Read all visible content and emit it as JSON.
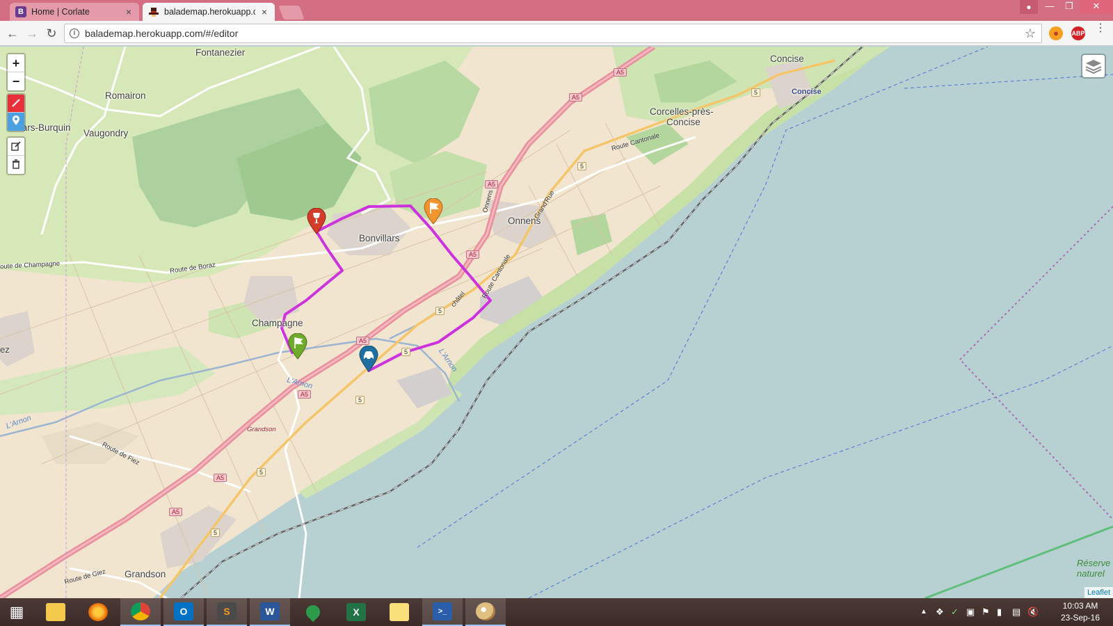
{
  "browser": {
    "tabs": [
      {
        "title": "Home | Corlate",
        "active": false,
        "favicon": "B"
      },
      {
        "title": "balademap.herokuapp.co",
        "active": true,
        "favicon": "hat-icon"
      }
    ],
    "url": "balademap.herokuapp.com/#/editor"
  },
  "map": {
    "places": [
      {
        "name": "Fontanezier"
      },
      {
        "name": "Romairon"
      },
      {
        "name": "Villars-Burquin"
      },
      {
        "name": "Vaugondry"
      },
      {
        "name": "Concise"
      },
      {
        "name": "Concise"
      },
      {
        "name": "Corcelles-près-"
      },
      {
        "name": "Concise"
      },
      {
        "name": "Onnens"
      },
      {
        "name": "Bonvillars"
      },
      {
        "name": "Champagne"
      },
      {
        "name": "Grandson"
      }
    ],
    "road_labels": [
      {
        "text": "Route Cantonale"
      },
      {
        "text": "Grand'Rue"
      },
      {
        "text": "Onnens"
      },
      {
        "text": "Route Cantonale"
      },
      {
        "text": "châtel"
      },
      {
        "text": "Route de Boraz"
      },
      {
        "text": "oute de Champagne"
      },
      {
        "text": "Route de Fiez"
      },
      {
        "text": "Route de Giez"
      },
      {
        "text": "Grandson"
      },
      {
        "text": "ez"
      }
    ],
    "shields": [
      {
        "text": "A5",
        "kind": "a5"
      },
      {
        "text": "A5",
        "kind": "a5"
      },
      {
        "text": "A5",
        "kind": "a5"
      },
      {
        "text": "A5",
        "kind": "a5"
      },
      {
        "text": "A5",
        "kind": "a5"
      },
      {
        "text": "A5",
        "kind": "a5"
      },
      {
        "text": "A5",
        "kind": "a5"
      },
      {
        "text": "A5",
        "kind": "a5"
      },
      {
        "text": "5",
        "kind": "r5"
      },
      {
        "text": "5",
        "kind": "r5"
      },
      {
        "text": "5",
        "kind": "r5"
      },
      {
        "text": "5",
        "kind": "r5"
      },
      {
        "text": "5",
        "kind": "r5"
      },
      {
        "text": "5",
        "kind": "r5"
      },
      {
        "text": "5",
        "kind": "r5"
      }
    ],
    "water_labels": [
      {
        "text": "L'Arnon"
      },
      {
        "text": "L'Arnon"
      },
      {
        "text": "L'Arnon"
      }
    ],
    "reserve_label": "Réserve naturel",
    "markers": [
      {
        "kind": "wine",
        "color": "#d33d29",
        "icon": "wine-glass-icon"
      },
      {
        "kind": "finish",
        "color": "#f0952f",
        "icon": "flag-icon"
      },
      {
        "kind": "start",
        "color": "#6fab2a",
        "icon": "flag-icon"
      },
      {
        "kind": "parking",
        "color": "#1f6fa0",
        "icon": "car-icon"
      }
    ],
    "route_color": "#cc33dd",
    "attribution": "Leaflet"
  },
  "controls": {
    "zoom_in": "+",
    "zoom_out": "−"
  },
  "taskbar": {
    "time": "10:03 AM",
    "date": "23-Sep-16",
    "apps": [
      {
        "name": "file-explorer",
        "label": ""
      },
      {
        "name": "firefox",
        "label": ""
      },
      {
        "name": "chrome",
        "label": ""
      },
      {
        "name": "outlook",
        "label": "O"
      },
      {
        "name": "sublime",
        "label": "S"
      },
      {
        "name": "word",
        "label": "W"
      },
      {
        "name": "maps",
        "label": ""
      },
      {
        "name": "excel",
        "label": "X"
      },
      {
        "name": "sticky-notes",
        "label": ""
      },
      {
        "name": "powershell",
        "label": ">_"
      },
      {
        "name": "paint",
        "label": ""
      }
    ]
  }
}
